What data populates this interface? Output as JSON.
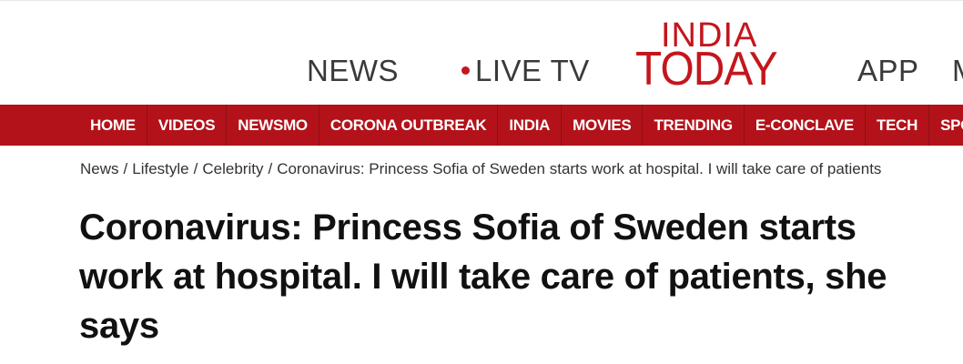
{
  "topnav": {
    "news": "NEWS",
    "live_tv": "LIVE TV",
    "app": "APP",
    "more_partial": "M"
  },
  "logo": {
    "line1": "INDIA",
    "line2": "TODAY",
    "color": "#c4161c"
  },
  "rednav": {
    "background": "#b3121a",
    "items": [
      {
        "label": "HOME"
      },
      {
        "label": "VIDEOS"
      },
      {
        "label": "NEWSMO"
      },
      {
        "label": "CORONA OUTBREAK"
      },
      {
        "label": "INDIA"
      },
      {
        "label": "MOVIES"
      },
      {
        "label": "TRENDING"
      },
      {
        "label": "E-CONCLAVE"
      },
      {
        "label": "TECH"
      },
      {
        "label": "SPORT"
      }
    ]
  },
  "breadcrumb": {
    "separator": "/",
    "items": [
      {
        "label": "News"
      },
      {
        "label": "Lifestyle"
      },
      {
        "label": "Celebrity"
      },
      {
        "label": "Coronavirus: Princess Sofia of Sweden starts work at hospital. I will take care of patients"
      }
    ]
  },
  "article": {
    "headline": "Coronavirus: Princess Sofia of Sweden starts work at hospital. I will take care of patients, she says"
  }
}
